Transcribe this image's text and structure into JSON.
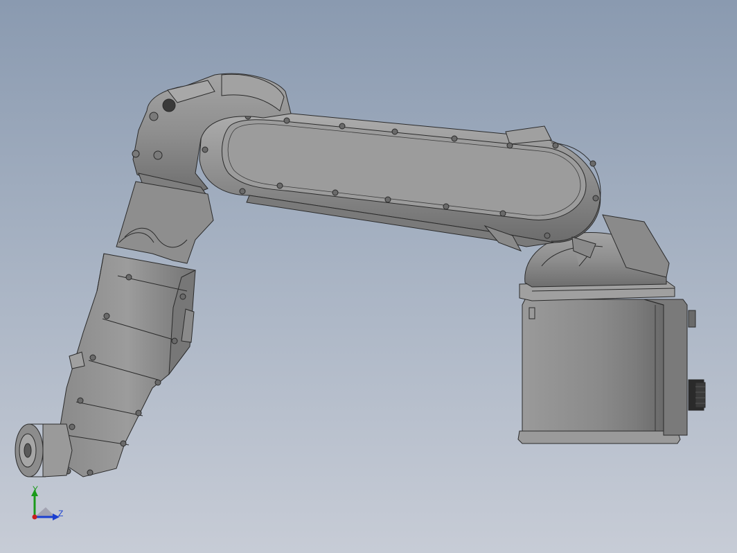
{
  "viewport": {
    "background_top": "#8a9ab0",
    "background_bottom": "#c7ccd6"
  },
  "model": {
    "subject": "robot-arm",
    "body_color": "#8c8c8c",
    "edge_color": "#2a2a2a"
  },
  "triad": {
    "y_label": "Y",
    "z_label": "Z",
    "y_color": "#1a9a1a",
    "z_color": "#1a3fd0",
    "x_color": "#c81e1e"
  }
}
